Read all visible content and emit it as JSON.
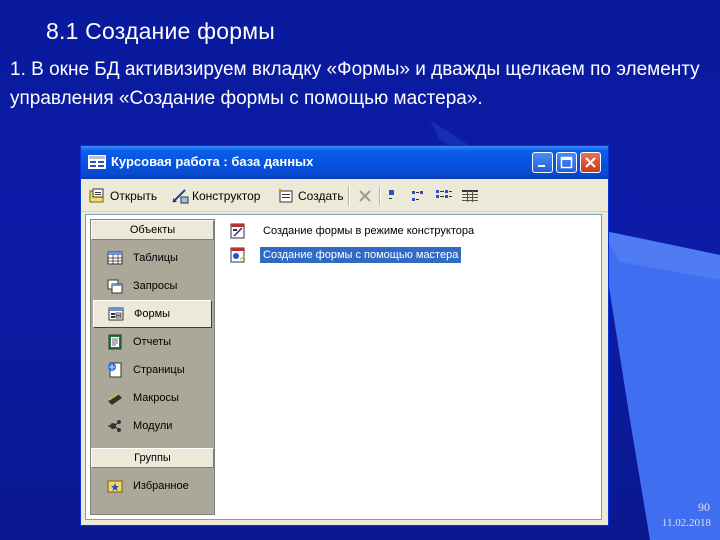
{
  "slide": {
    "title": "8.1 Создание формы",
    "body": "1. В окне БД активизируем вкладку «Формы» и дважды щелкаем по элементу управления «Создание формы с помощью мастера».",
    "page_number": "90",
    "date": "11.02.2018"
  },
  "window": {
    "title": "Курсовая работа : база данных",
    "toolbar": {
      "open": "Открыть",
      "design": "Конструктор",
      "create": "Создать"
    },
    "objects_bar": {
      "objects_header": "Объекты",
      "items": [
        {
          "label": "Таблицы",
          "icon": "table-icon"
        },
        {
          "label": "Запросы",
          "icon": "query-icon"
        },
        {
          "label": "Формы",
          "icon": "form-icon",
          "selected": true
        },
        {
          "label": "Отчеты",
          "icon": "report-icon"
        },
        {
          "label": "Страницы",
          "icon": "page-icon"
        },
        {
          "label": "Макросы",
          "icon": "macro-icon"
        },
        {
          "label": "Модули",
          "icon": "module-icon"
        }
      ],
      "groups_header": "Группы",
      "groups": [
        {
          "label": "Избранное",
          "icon": "favorites-icon"
        }
      ]
    },
    "list": [
      {
        "label": "Создание формы в режиме конструктора",
        "icon": "design-form-icon"
      },
      {
        "label": "Создание формы с помощью мастера",
        "icon": "wizard-form-icon",
        "selected": true
      }
    ]
  },
  "colors": {
    "slide_background": "#0c1ca8",
    "accent_shape": "#3f6ff0",
    "xp_title_blue": "#0554e0",
    "selection": "#316ac5"
  }
}
